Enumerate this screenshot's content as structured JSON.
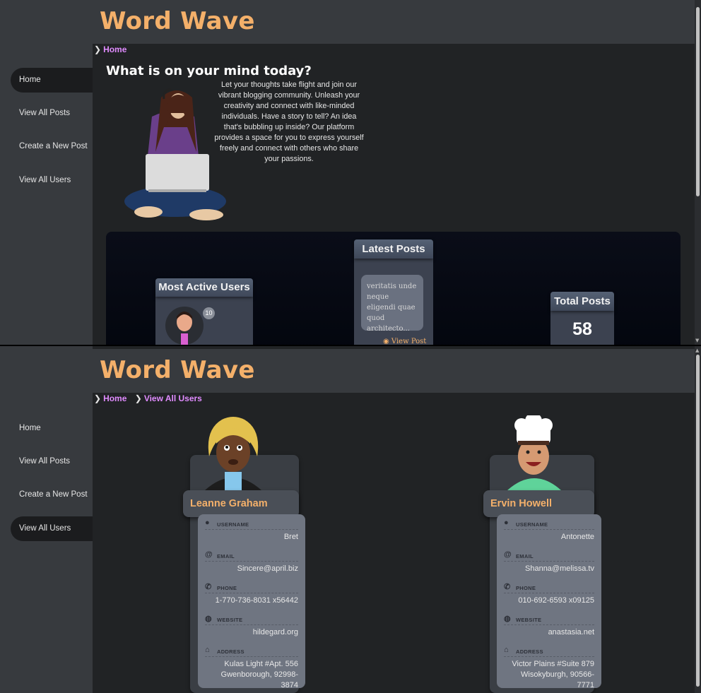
{
  "app": {
    "brand": "Word Wave"
  },
  "nav": [
    {
      "label": "Home"
    },
    {
      "label": "View All Posts"
    },
    {
      "label": "Create a New Post"
    },
    {
      "label": "View All Users"
    }
  ],
  "home": {
    "breadcrumb": [
      "Home"
    ],
    "title": "What is on your mind today?",
    "intro": "Let your thoughts take flight and join our vibrant blogging community. Unleash your creativity and connect with like-minded individuals. Have a story to tell? An idea that's bubbling up inside? Our platform provides a space for you to express yourself freely and connect with others who share your passions.",
    "most_active_title": "Most Active Users",
    "most_active_badge": "10",
    "latest_posts_title": "Latest Posts",
    "latest_post_excerpt": "veritatis unde neque eligendi quae quod architecto...",
    "view_post_label": "View Post",
    "total_posts_title": "Total Posts",
    "total_posts_value": "58"
  },
  "users_page": {
    "breadcrumb": [
      "Home",
      "View All Users"
    ],
    "users": [
      {
        "name": "Leanne Graham",
        "username": "Bret",
        "email": "Sincere@april.biz",
        "phone": "1-770-736-8031 x56442",
        "website": "hildegard.org",
        "address_line1": "Kulas Light #Apt. 556",
        "address_line2": "Gwenborough, 92998-3874"
      },
      {
        "name": "Ervin Howell",
        "username": "Antonette",
        "email": "Shanna@melissa.tv",
        "phone": "010-692-6593 x09125",
        "website": "anastasia.net",
        "address_line1": "Victor Plains #Suite 879",
        "address_line2": "Wisokyburgh, 90566-7771"
      }
    ],
    "field_labels": {
      "username": "USERNAME",
      "email": "EMAIL",
      "phone": "PHONE",
      "website": "WEBSITE",
      "address": "ADDRESS"
    }
  },
  "colors": {
    "brand": "#f4b06a",
    "link": "#e08bff",
    "sidebar": "#373a3e",
    "background": "#212325"
  }
}
